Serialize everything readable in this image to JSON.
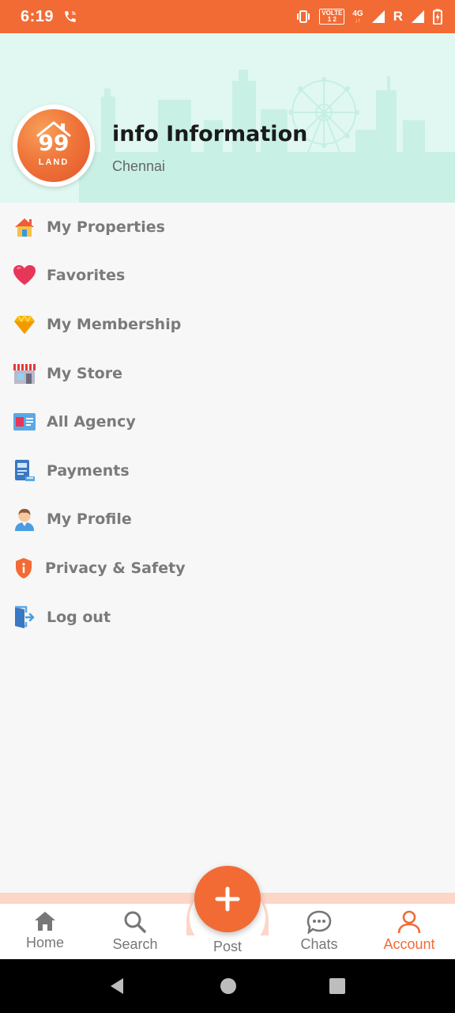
{
  "status": {
    "time": "6:19",
    "volte_top": "VOLTE",
    "volte_bottom": "1 2",
    "network": "4G",
    "roaming": "R"
  },
  "profile": {
    "logo_number": "99",
    "logo_text": "LAND",
    "name": "info Information",
    "city": "Chennai"
  },
  "menu": [
    {
      "label": "My Properties",
      "icon": "house-icon"
    },
    {
      "label": "Favorites",
      "icon": "heart-icon"
    },
    {
      "label": "My Membership",
      "icon": "diamond-icon"
    },
    {
      "label": "My Store",
      "icon": "store-icon"
    },
    {
      "label": "All Agency",
      "icon": "agency-card-icon"
    },
    {
      "label": "Payments",
      "icon": "payment-icon"
    },
    {
      "label": "My Profile",
      "icon": "person-icon"
    },
    {
      "label": "Privacy & Safety",
      "icon": "shield-icon"
    },
    {
      "label": "Log out",
      "icon": "logout-icon"
    }
  ],
  "bottom_nav": {
    "home": "Home",
    "search": "Search",
    "post": "Post",
    "chats": "Chats",
    "account": "Account",
    "active": "Account"
  },
  "colors": {
    "accent": "#f26b35",
    "header_bg": "#e0f8f1",
    "skyline": "#c6efe4"
  }
}
